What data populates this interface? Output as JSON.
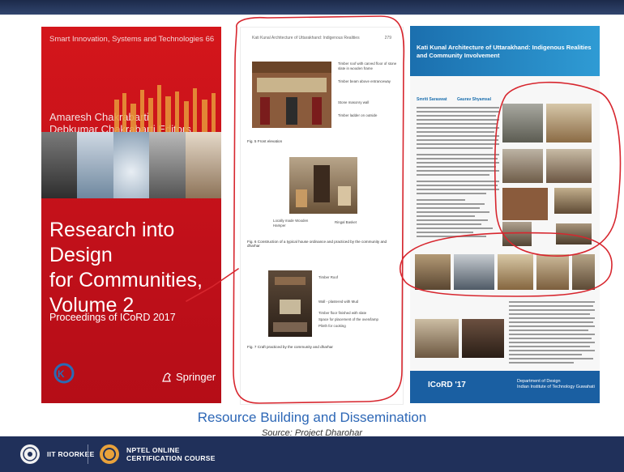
{
  "book": {
    "series": "Smart Innovation, Systems and Technologies  66",
    "authors": [
      "Amaresh Chakrabarti",
      "Debkumar Chakrabarti  Editors"
    ],
    "title_lines": [
      "Research into Design",
      "for Communities,",
      "Volume 2"
    ],
    "subtitle": "Proceedings of ICoRD 2017",
    "publisher": "Springer"
  },
  "paper": {
    "header_left": "Kati Kunal Architecture of Uttarakhand: Indigenous Realities",
    "header_right": "279",
    "captions": [
      "Fig. 5  Front elevation",
      "Fig. 6  Construction of a typical house ordinance and practiced by the community and dharhar",
      "Fig. 7  Craft practiced by the community and dharhar"
    ],
    "fig1_notes": [
      "Timber roof with carved floor of stone slate in wooden frame",
      "Timber beam above entranceway",
      "Stone masonry wall",
      "Timber ladder on outside"
    ],
    "fig2_notes": [
      "Locally made Wooden Hamper",
      "Ringal Basket"
    ],
    "fig3_notes": [
      "Timber Roof",
      "Wall - plastered with Mud",
      "Timber floor finished with slate",
      "Space for placement of the oven/lamp",
      "Plinth for cooking"
    ]
  },
  "poster": {
    "title": "Kati Kunal Architecture of Uttarakhand: Indigenous Realities and Community Involvement",
    "col_headings": [
      "Smriti Saraswat",
      "Gaurav Shyamsal"
    ],
    "footer_logo": "ICoRD '17",
    "footer_right": "Department of Design\nIndian Institute of Technology Guwahati"
  },
  "footer": {
    "title": "Resource Building and Dissemination",
    "source": "Source: Project Dharohar"
  },
  "bottom_bar": {
    "iit_label": "IIT ROORKEE",
    "nptel_line1": "NPTEL ONLINE",
    "nptel_line2": "CERTIFICATION COURSE"
  },
  "colors": {
    "cover_red": "#c8121a",
    "annotation_red": "#d7262e",
    "footer_title_blue": "#2d67b6",
    "bar_navy": "#20305a"
  }
}
